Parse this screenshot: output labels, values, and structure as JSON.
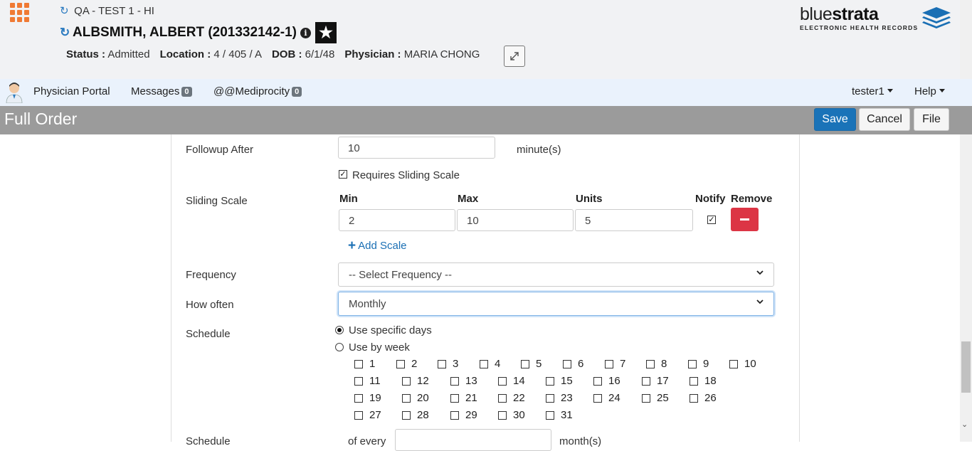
{
  "header": {
    "environment": "QA - TEST 1 - HI",
    "patient_name": "ALBSMITH, ALBERT (201332142-1)",
    "status_label": "Status :",
    "status_value": "Admitted",
    "location_label": "Location :",
    "location_value": "4 / 405 / A",
    "dob_label": "DOB :",
    "dob_value": "6/1/48",
    "physician_label": "Physician :",
    "physician_value": "MARIA CHONG",
    "logo_part1": "blue",
    "logo_part2": "strata",
    "logo_sub": "ELECTRONIC HEALTH RECORDS"
  },
  "nav": {
    "portal": "Physician Portal",
    "messages": "Messages",
    "messages_count": "0",
    "mediprocity": "@@Mediprocity",
    "mediprocity_count": "0",
    "user": "tester1",
    "help": "Help"
  },
  "orderbar": {
    "title": "Full Order",
    "save": "Save",
    "cancel": "Cancel",
    "file": "File"
  },
  "form": {
    "followup_label": "Followup After",
    "followup_value": "10",
    "followup_unit": "minute(s)",
    "requires_sliding_label": "Requires Sliding Scale",
    "sliding_label": "Sliding Scale",
    "col_min": "Min",
    "col_max": "Max",
    "col_units": "Units",
    "col_notify": "Notify",
    "col_remove": "Remove",
    "row_min": "2",
    "row_max": "10",
    "row_units": "5",
    "add_scale": "Add Scale",
    "frequency_label": "Frequency",
    "frequency_value": "-- Select Frequency --",
    "how_often_label": "How often",
    "how_often_value": "Monthly",
    "schedule_label": "Schedule",
    "radio_specific": "Use specific days",
    "radio_week": "Use by week",
    "days": [
      "1",
      "2",
      "3",
      "4",
      "5",
      "6",
      "7",
      "8",
      "9",
      "10",
      "11",
      "12",
      "13",
      "14",
      "15",
      "16",
      "17",
      "18",
      "19",
      "20",
      "21",
      "22",
      "23",
      "24",
      "25",
      "26",
      "27",
      "28",
      "29",
      "30",
      "31"
    ],
    "schedule2_label": "Schedule",
    "of_every": "of every",
    "months_unit": "month(s)"
  }
}
